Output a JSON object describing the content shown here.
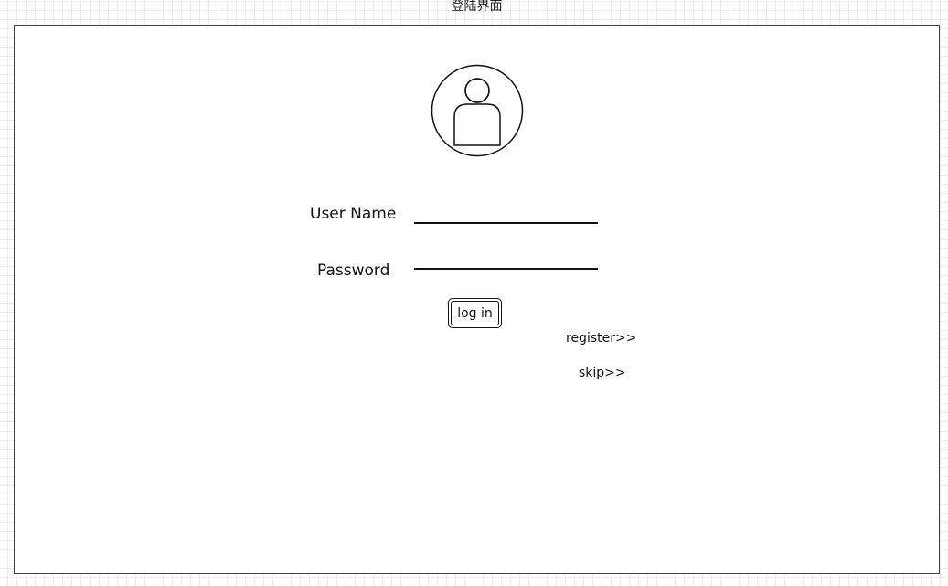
{
  "page": {
    "title": "登陆界面"
  },
  "login": {
    "avatar_icon": "user-avatar-icon",
    "username_label": "User Name",
    "password_label": "Password",
    "login_button_label": "log in",
    "register_link": "register>>",
    "skip_link": "skip>>"
  }
}
